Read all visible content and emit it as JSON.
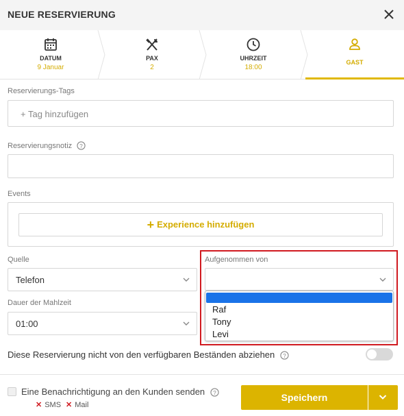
{
  "header": {
    "title": "NEUE RESERVIERUNG"
  },
  "steps": [
    {
      "label": "DATUM",
      "value": "9 Januar",
      "icon": "calendar-icon"
    },
    {
      "label": "PAX",
      "value": "2",
      "icon": "cutlery-icon"
    },
    {
      "label": "UHRZEIT",
      "value": "18:00",
      "icon": "clock-icon"
    },
    {
      "label": "GAST",
      "value": "",
      "icon": "user-icon",
      "active": true
    }
  ],
  "form": {
    "tags_label": "Reservierungs-Tags",
    "tags_placeholder": "+ Tag hinzufügen",
    "note_label": "Reservierungsnotiz",
    "events_label": "Events",
    "experience_button": "Experience hinzufügen",
    "source_label": "Quelle",
    "source_value": "Telefon",
    "taken_by_label": "Aufgenommen von",
    "taken_by_value": "",
    "taken_by_options": [
      "",
      "Raf",
      "Tony",
      "Levi"
    ],
    "duration_label": "Dauer der Mahlzeit",
    "duration_value": "01:00",
    "deduct_label": "Diese Reservierung nicht von den verfügbaren Beständen abziehen",
    "deduct_enabled": false
  },
  "footer": {
    "notify_label": "Eine Benachrichtigung an den Kunden senden",
    "channels": [
      "SMS",
      "Mail"
    ],
    "save_label": "Speichern"
  },
  "colors": {
    "accent": "#dcb400",
    "highlight": "#d0191f",
    "selected_option": "#1a73e8"
  }
}
